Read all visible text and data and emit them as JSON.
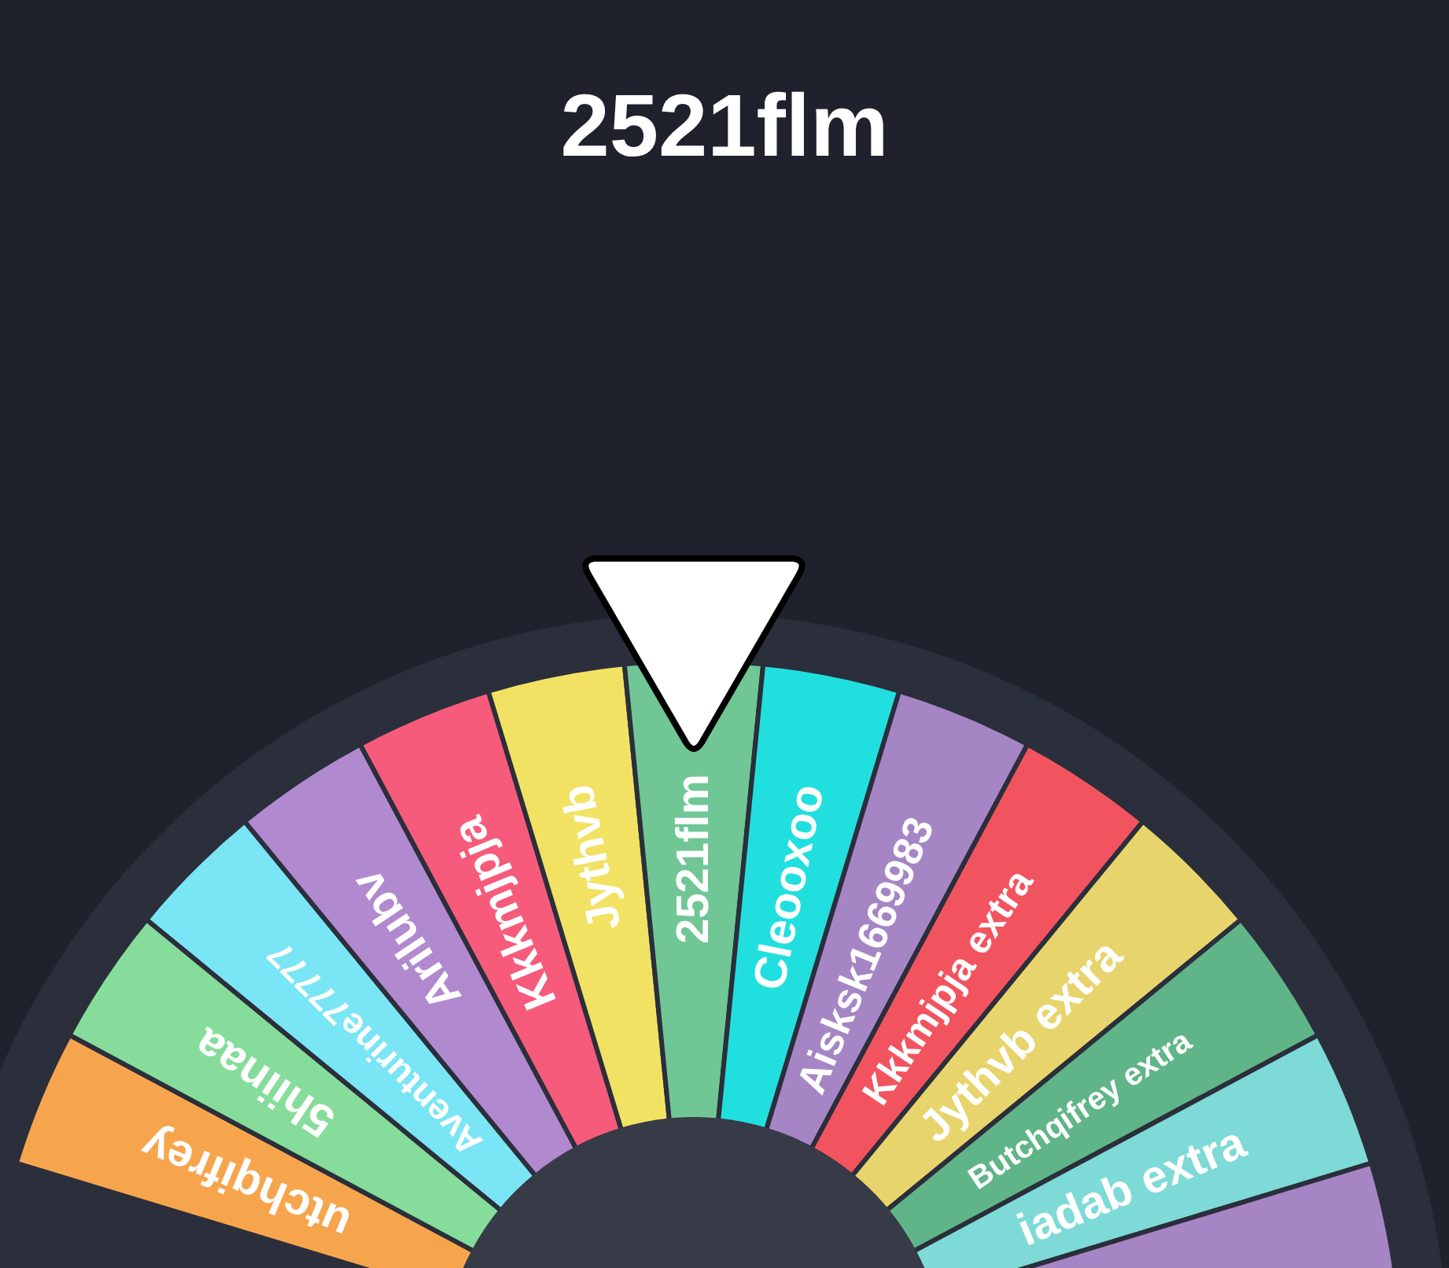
{
  "title": "2521flm",
  "wheel": {
    "segments": [
      {
        "label": "utchqifrey",
        "color": "#f7a54d"
      },
      {
        "label": "5hiinaa",
        "color": "#86dc9a"
      },
      {
        "label": "Aventurine77777",
        "color": "#7ae5f5"
      },
      {
        "label": "Arilubv",
        "color": "#b189cf"
      },
      {
        "label": "Kkkmjpja",
        "color": "#f65b7b"
      },
      {
        "label": "Jythvb",
        "color": "#f1e263"
      },
      {
        "label": "2521flm",
        "color": "#70c795"
      },
      {
        "label": "Cleooxoo",
        "color": "#22dfdf"
      },
      {
        "label": "Aisksk1669983",
        "color": "#a685c5"
      },
      {
        "label": "Kkkmjpja extra",
        "color": "#f2545f"
      },
      {
        "label": "Jythvb extra",
        "color": "#e8d46c"
      },
      {
        "label": "Butchqifrey extra",
        "color": "#5fb587"
      },
      {
        "label": "iadab extra",
        "color": "#7edad6"
      },
      {
        "color": "#a685c5"
      }
    ]
  }
}
